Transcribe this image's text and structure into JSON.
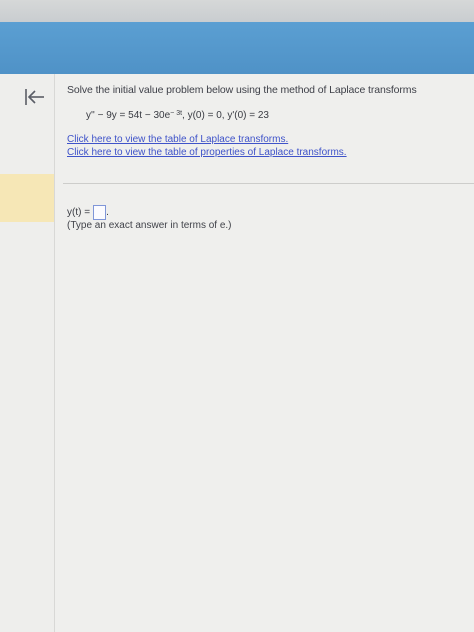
{
  "question": {
    "prompt": "Solve the initial value problem below using the method of Laplace transforms",
    "equation": {
      "lhs": "y'' − 9y = 54t − 30e",
      "exponent": "− 3t",
      "conditions": ", y(0) = 0, y'(0) = 23"
    }
  },
  "links": {
    "laplace_table": "Click here to view the table of Laplace transforms.",
    "properties_table": "Click here to view the table of properties of Laplace transforms."
  },
  "answer": {
    "label": "y(t) =",
    "suffix": ".",
    "hint": "(Type an exact answer in terms of e.)"
  },
  "icons": {
    "back": "arrow-left-to-bar-icon"
  },
  "colors": {
    "banner": "#4f92c7",
    "link": "#3f53c9",
    "highlight": "#f6e7b6"
  }
}
